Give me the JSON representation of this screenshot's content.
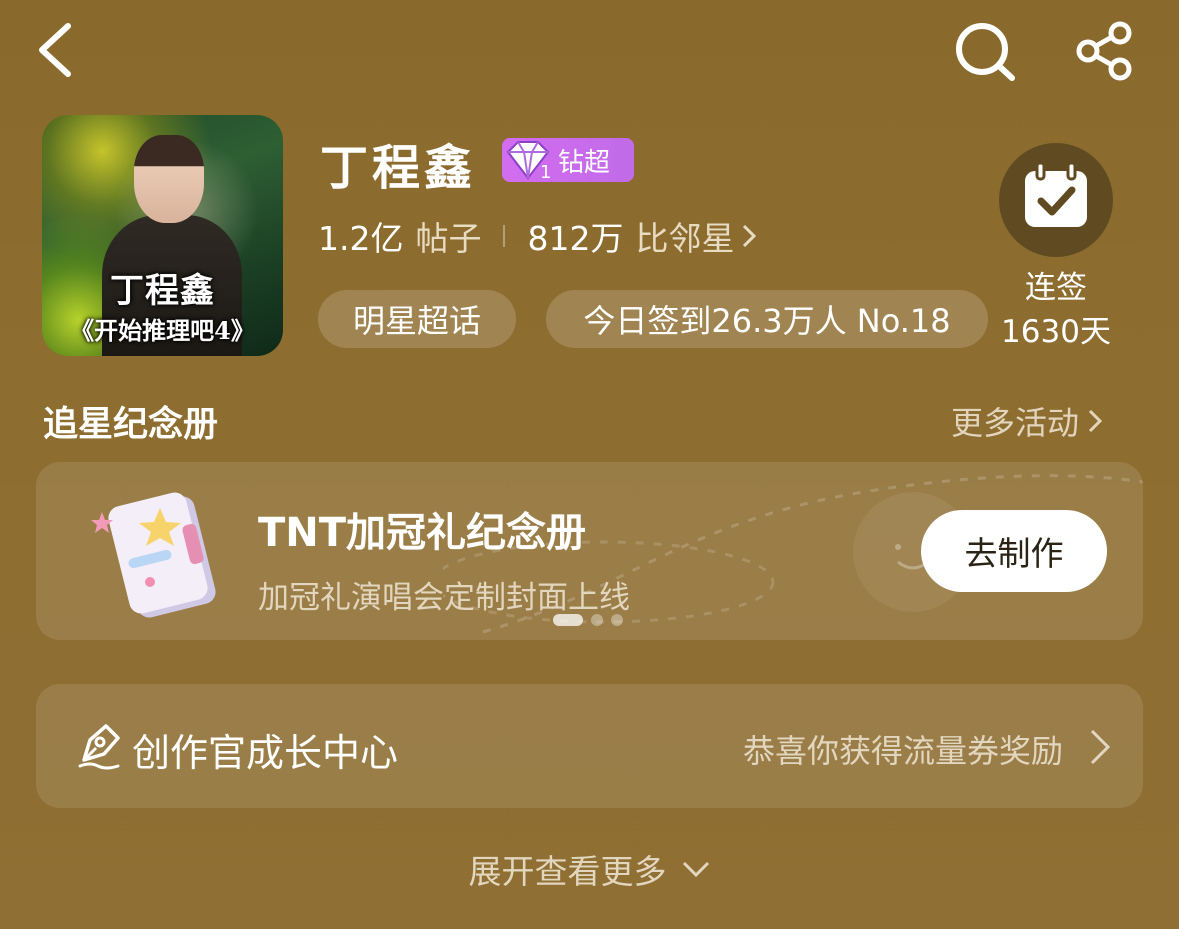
{
  "header": {
    "back_icon": "chevron-left-icon",
    "search_icon": "search-icon",
    "share_icon": "share-icon"
  },
  "topic": {
    "cover_name": "丁程鑫",
    "cover_show": "《开始推理吧4》",
    "name": "丁程鑫",
    "tier_level": "1",
    "tier_label": "钻超",
    "posts_count": "1.2亿",
    "posts_unit": "帖子",
    "fans_count": "812万",
    "fans_unit": "比邻星",
    "type_chip": "明星超话",
    "checkin_today": "今日签到26.3万人 No.18",
    "checkin_label": "连签",
    "checkin_days": "1630天"
  },
  "memorial": {
    "title": "追星纪念册",
    "more_label": "更多活动",
    "card_title": "TNT加冠礼纪念册",
    "card_subtitle": "加冠礼演唱会定制封面上线",
    "card_button": "去制作"
  },
  "creator_center": {
    "title": "创作官成长中心",
    "note": "恭喜你获得流量券奖励"
  },
  "expand_label": "展开查看更多",
  "colors": {
    "background": "#8d6d30",
    "badge": "#c96cec",
    "checkin_circle": "#5f4a22"
  }
}
